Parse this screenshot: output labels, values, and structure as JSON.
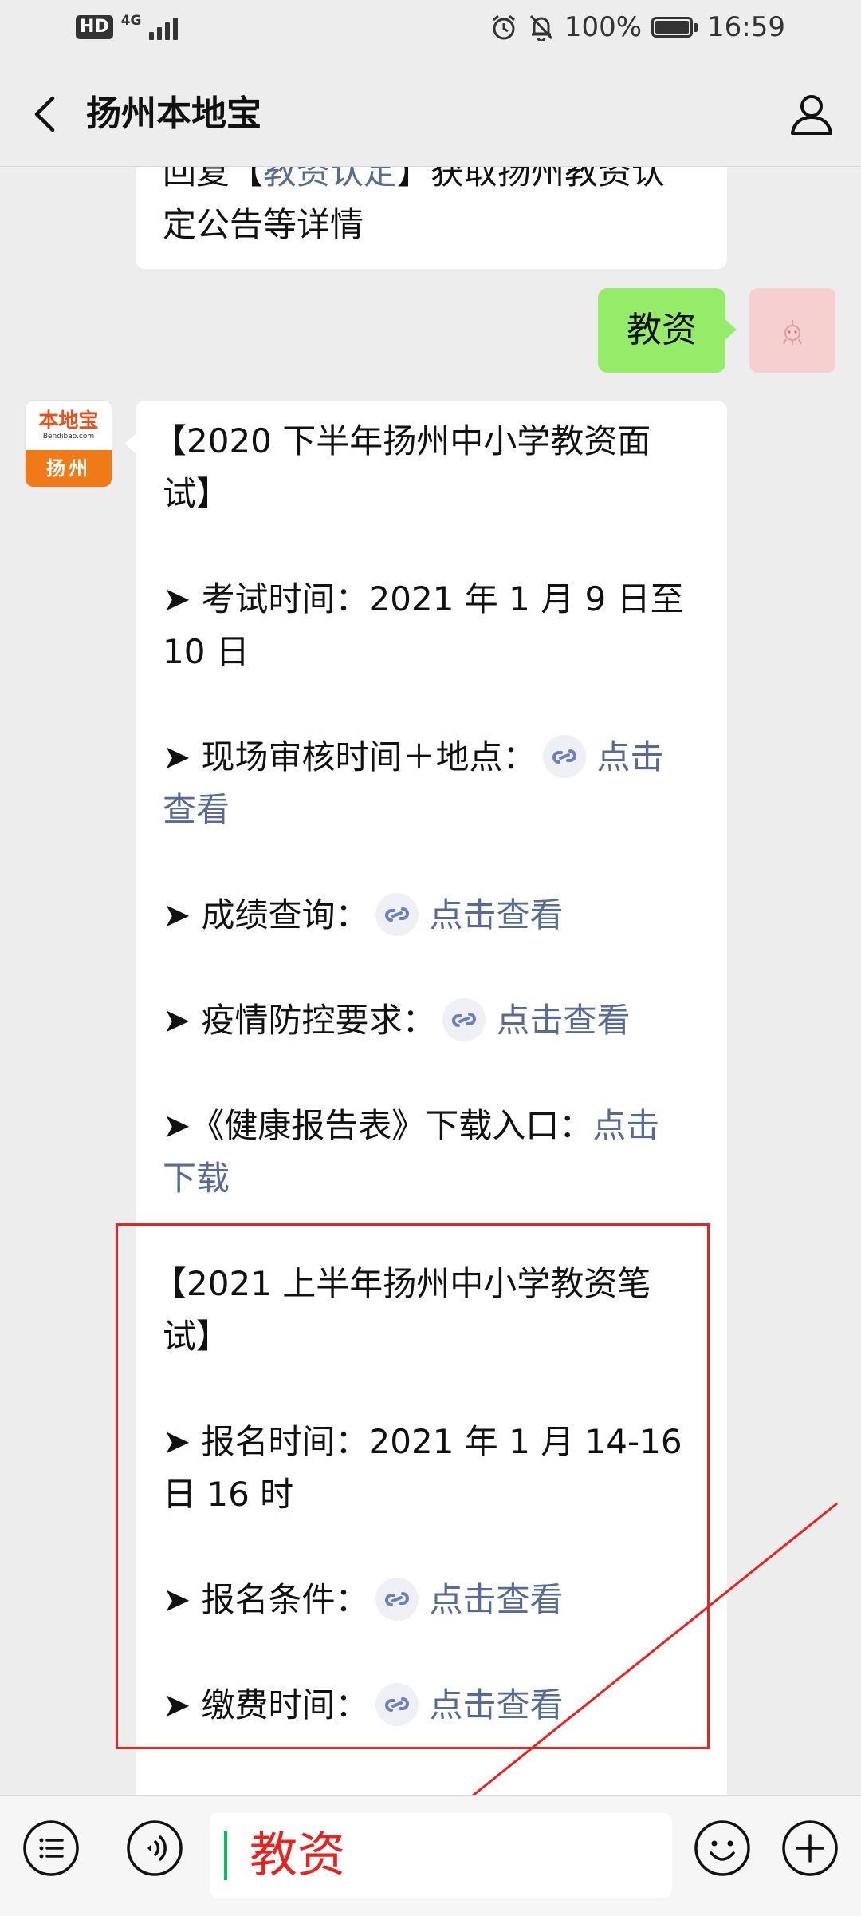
{
  "status_bar": {
    "hd": "HD",
    "network": "4G",
    "battery_pct": "100%",
    "battery_level": 1.0,
    "time": "16:59"
  },
  "header": {
    "title": "扬州本地宝"
  },
  "messages": {
    "previous": {
      "line1_start": "回复【",
      "line1_link": "教资认定",
      "line1_end": "】获取扬州教资认",
      "line2": "定公告等详情"
    },
    "user_message": "教资",
    "bot_avatar": {
      "brand": "本地宝",
      "domain": "Bendibao.com",
      "city": "扬州"
    },
    "reply": {
      "interview_title_1": "【2020 下半年扬州中小学教资面",
      "interview_title_2": "试】",
      "exam_time_1": "➤ 考试时间：2021 年 1 月 9 日至",
      "exam_time_2": "10 日",
      "review_label": "➤ 现场审核时间＋地点：",
      "review_link_1": "点击",
      "review_link_2": "查看",
      "score_label": "➤ 成绩查询：",
      "score_link": "点击查看",
      "epidemic_label": "➤ 疫情防控要求：",
      "epidemic_link": "点击查看",
      "health_label": "➤《健康报告表》下载入口：",
      "health_link_1": "点击",
      "health_link_2": "下载",
      "written_title_1": "【2021 上半年扬州中小学教资笔",
      "written_title_2": "试】",
      "reg_time_1": "➤ 报名时间：2021 年 1 月 14-16",
      "reg_time_2": "日 16 时",
      "reg_cond_label": "➤ 报名条件：",
      "reg_cond_link": "点击查看",
      "fee_label": "➤ 缴费时间：",
      "fee_link": "点击查看"
    }
  },
  "input": {
    "value": "教资"
  },
  "colors": {
    "link": "#576b95",
    "user_bubble": "#95ec69",
    "annotation": "#e8231f",
    "brand_orange": "#f07a18"
  },
  "icons": [
    "back-arrow-icon",
    "person-icon",
    "mini-program-link-icon",
    "menu-list-icon",
    "voice-icon",
    "emoji-icon",
    "plus-icon"
  ]
}
